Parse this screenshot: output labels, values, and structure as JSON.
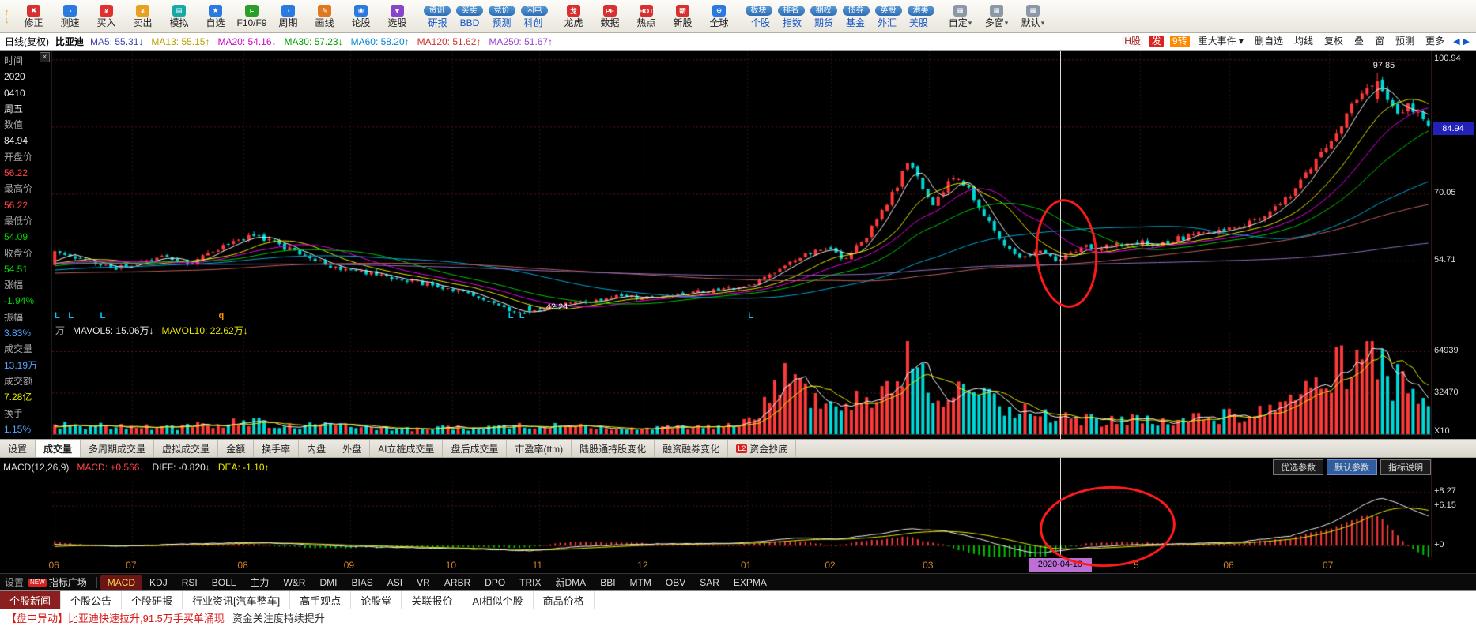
{
  "toolbar": {
    "nav_up": "↑",
    "nav_down": "↓",
    "items": [
      {
        "label": "修正",
        "glyph": "✖",
        "ic": "#d83030"
      },
      {
        "label": "测速",
        "glyph": "◔",
        "ic": "#2a7ae0"
      },
      {
        "label": "买入",
        "glyph": "¥",
        "ic": "#e03030"
      },
      {
        "label": "卖出",
        "glyph": "¥",
        "ic": "#e8a020"
      },
      {
        "label": "模拟",
        "glyph": "▤",
        "ic": "#18a8a8"
      },
      {
        "label": "自选",
        "glyph": "★",
        "ic": "#2a7ae0"
      },
      {
        "label": "F10/F9",
        "glyph": "F",
        "ic": "#28a028"
      },
      {
        "label": "周期",
        "glyph": "◔",
        "ic": "#2a7ae0"
      },
      {
        "label": "画线",
        "glyph": "✎",
        "ic": "#e07820"
      },
      {
        "label": "论股",
        "glyph": "◉",
        "ic": "#2a7ae0"
      },
      {
        "label": "选股",
        "glyph": "▼",
        "ic": "#8844cc"
      }
    ],
    "pills_a": [
      "资讯",
      "买卖",
      "竞价",
      "闪电"
    ],
    "links_a": [
      "研报",
      "BBD",
      "预测",
      "科创"
    ],
    "mid_items": [
      {
        "label": "龙虎",
        "glyph": "龙",
        "ic": "#d83030"
      },
      {
        "label": "数据",
        "glyph": "PE",
        "ic": "#d83030"
      },
      {
        "label": "热点",
        "glyph": "HOT",
        "ic": "#d83030"
      },
      {
        "label": "新股",
        "glyph": "新",
        "ic": "#d83030"
      },
      {
        "label": "全球",
        "glyph": "⊕",
        "ic": "#2a7ae0"
      }
    ],
    "pills_b": [
      "板块",
      "排名",
      "期权",
      "债券",
      "英股",
      "港美"
    ],
    "links_b": [
      "个股",
      "指数",
      "期货",
      "基金",
      "外汇",
      "美股"
    ],
    "end_items": [
      {
        "label": "自定",
        "glyph": "▦"
      },
      {
        "label": "多窗",
        "glyph": "▦"
      },
      {
        "label": "默认",
        "glyph": "▦"
      }
    ],
    "caret": "▾"
  },
  "chart_header": {
    "period": "日线(复权)",
    "stock": "比亚迪",
    "mas": [
      {
        "k": "MA5:",
        "v": "55.31",
        "d": "↓",
        "c": "#4444aa"
      },
      {
        "k": "MA13:",
        "v": "55.15",
        "d": "↑",
        "c": "#b8a000"
      },
      {
        "k": "MA20:",
        "v": "54.16",
        "d": "↓",
        "c": "#cc00cc"
      },
      {
        "k": "MA30:",
        "v": "57.23",
        "d": "↓",
        "c": "#00a000"
      },
      {
        "k": "MA60:",
        "v": "58.20",
        "d": "↑",
        "c": "#0088cc"
      },
      {
        "k": "MA120:",
        "v": "51.62",
        "d": "↑",
        "c": "#cc3333"
      },
      {
        "k": "MA250:",
        "v": "51.67",
        "d": "↑",
        "c": "#9944cc"
      }
    ],
    "right_items": [
      {
        "t": "H股",
        "bg": "#f7f7f7",
        "fg": "#aa2222"
      },
      {
        "t": "发",
        "bg": "#dd2222",
        "fg": "#ffffff"
      },
      {
        "t": "9转",
        "bg": "#ff8800",
        "fg": "#ffffff"
      },
      {
        "t": "重大事件 ▾",
        "bg": "",
        "fg": "#222222"
      },
      {
        "t": "删自选",
        "bg": "",
        "fg": "#222222"
      },
      {
        "t": "均线",
        "bg": "",
        "fg": "#222222"
      },
      {
        "t": "复权",
        "bg": "",
        "fg": "#222222"
      },
      {
        "t": "叠",
        "bg": "",
        "fg": "#222222"
      },
      {
        "t": "窗",
        "bg": "",
        "fg": "#222222"
      },
      {
        "t": "预测",
        "bg": "",
        "fg": "#222222"
      },
      {
        "t": "更多",
        "bg": "",
        "fg": "#222222"
      }
    ],
    "nav_left": "◀",
    "nav_right": "▶"
  },
  "info_panel": {
    "close_glyph": "×",
    "rows": [
      {
        "t": "时间",
        "c": "#a8a8a8"
      },
      {
        "t": "2020",
        "c": "#e8e8e8"
      },
      {
        "t": "0410",
        "c": "#e8e8e8"
      },
      {
        "t": "周五",
        "c": "#e8e8e8"
      },
      {
        "t": "数值",
        "c": "#a8a8a8"
      },
      {
        "t": "84.94",
        "c": "#e8e8e8"
      },
      {
        "t": "开盘价",
        "c": "#a8a8a8"
      },
      {
        "t": "56.22",
        "c": "#ff4545"
      },
      {
        "t": "最高价",
        "c": "#a8a8a8"
      },
      {
        "t": "56.22",
        "c": "#ff4545"
      },
      {
        "t": "最低价",
        "c": "#a8a8a8"
      },
      {
        "t": "54.09",
        "c": "#00d800"
      },
      {
        "t": "收盘价",
        "c": "#a8a8a8"
      },
      {
        "t": "54.51",
        "c": "#00d800"
      },
      {
        "t": "涨幅",
        "c": "#a8a8a8"
      },
      {
        "t": "-1.94%",
        "c": "#00d800"
      },
      {
        "t": "振幅",
        "c": "#a8a8a8"
      },
      {
        "t": "3.83%",
        "c": "#58a6ff"
      },
      {
        "t": "成交量",
        "c": "#a8a8a8"
      },
      {
        "t": "13.19万",
        "c": "#58a6ff"
      },
      {
        "t": "成交额",
        "c": "#a8a8a8"
      },
      {
        "t": "7.28亿",
        "c": "#e8e800"
      },
      {
        "t": "换手",
        "c": "#a8a8a8"
      },
      {
        "t": "1.15%",
        "c": "#58a6ff"
      }
    ]
  },
  "volume_header": {
    "unit": "万",
    "ma5_label": "MAVOL5:",
    "ma5_value": "15.06万",
    "ma5_dir": "↓",
    "ma10_label": "MAVOL10:",
    "ma10_value": "22.62万",
    "ma10_dir": "↓"
  },
  "func_tabs": {
    "items": [
      {
        "t": "设置"
      },
      {
        "t": "成交量",
        "active": true
      },
      {
        "t": "多周期成交量"
      },
      {
        "t": "虚拟成交量"
      },
      {
        "t": "金额"
      },
      {
        "t": "换手率"
      },
      {
        "t": "内盘"
      },
      {
        "t": "外盘"
      },
      {
        "t": "AI立桩成交量"
      },
      {
        "t": "盘后成交量"
      },
      {
        "t": "市盈率(ttm)"
      },
      {
        "t": "陆股通持股变化"
      },
      {
        "t": "融资融券变化"
      },
      {
        "t": "资金抄底",
        "badge": "L2"
      }
    ]
  },
  "macd_panel": {
    "title": "MACD(12,26,9)",
    "values": [
      {
        "k": "MACD:",
        "v": "+0.566",
        "d": "↓",
        "c": "#ff4545"
      },
      {
        "k": "DIFF:",
        "v": "-0.820",
        "d": "↓",
        "c": "#e8e8e8"
      },
      {
        "k": "DEA:",
        "v": "-1.10",
        "d": "↑",
        "c": "#e8e800"
      }
    ],
    "buttons": [
      {
        "t": "优选参数"
      },
      {
        "t": "默认参数",
        "active": true
      },
      {
        "t": "指标说明"
      }
    ]
  },
  "indicator_tabs": {
    "settings": "设置",
    "new_badge": "NEW",
    "plaza": "指标广场",
    "items": [
      {
        "t": "MACD",
        "active": true
      },
      {
        "t": "KDJ"
      },
      {
        "t": "RSI"
      },
      {
        "t": "BOLL"
      },
      {
        "t": "主力"
      },
      {
        "t": "W&R"
      },
      {
        "t": "DMI"
      },
      {
        "t": "BIAS"
      },
      {
        "t": "ASI"
      },
      {
        "t": "VR"
      },
      {
        "t": "ARBR"
      },
      {
        "t": "DPO"
      },
      {
        "t": "TRIX"
      },
      {
        "t": "新DMA"
      },
      {
        "t": "BBI"
      },
      {
        "t": "MTM"
      },
      {
        "t": "OBV"
      },
      {
        "t": "SAR"
      },
      {
        "t": "EXPMA"
      }
    ]
  },
  "news_tabs": {
    "items": [
      {
        "t": "个股新闻",
        "active": true
      },
      {
        "t": "个股公告"
      },
      {
        "t": "个股研报"
      },
      {
        "t": "行业资讯[汽车整车]"
      },
      {
        "t": "高手观点"
      },
      {
        "t": "论股堂"
      },
      {
        "t": "关联报价"
      },
      {
        "t": "AI相似个股"
      },
      {
        "t": "商品价格"
      }
    ]
  },
  "news_area": {
    "headline_red": "【盘中异动】比亚迪快速拉升,91.5万手买单涌现",
    "headline_black": "资金关注度持续提升"
  },
  "crosshair": {
    "date": "2020-04-10",
    "price": "84.94",
    "price_value": 84.94,
    "x_fraction": 0.731
  },
  "annotations": {
    "low_label": "←42.24",
    "low_f": 0.352,
    "low_price": 44.0,
    "high_label": "97.85",
    "high_f": 0.958,
    "high_price": 99.5,
    "markers": [
      {
        "t": "L",
        "f": 0.004,
        "c": "#00c8ff"
      },
      {
        "t": "L",
        "f": 0.014,
        "c": "#00c8ff"
      },
      {
        "t": "L",
        "f": 0.037,
        "c": "#00c8ff"
      },
      {
        "t": "q",
        "f": 0.123,
        "c": "#ff9000"
      },
      {
        "t": "L",
        "f": 0.333,
        "c": "#00c8ff"
      },
      {
        "t": "L",
        "f": 0.341,
        "c": "#00c8ff"
      },
      {
        "t": "L",
        "f": 0.507,
        "c": "#00c8ff"
      }
    ]
  },
  "chart_data": {
    "type": "candlestick",
    "symbol": "比亚迪",
    "period": "日线(复权)",
    "candle_count": 270,
    "price_range": [
      40.5,
      103
    ],
    "price_gridlines": [
      100.94,
      85.5,
      70.05,
      54.71
    ],
    "price_axis_labels": [
      {
        "v": 100.94,
        "t": "100.94"
      },
      {
        "v": 70.05,
        "t": "70.05"
      },
      {
        "v": 54.71,
        "t": "54.71"
      }
    ],
    "key_points": {
      "low": 42.24,
      "high": 97.85,
      "crosshair_price": 84.94,
      "crosshair_date": "2020-04-10"
    },
    "price_anchors": [
      [
        0,
        56.5
      ],
      [
        0.02,
        55
      ],
      [
        0.045,
        53
      ],
      [
        0.058,
        54
      ],
      [
        0.08,
        55.5
      ],
      [
        0.1,
        54
      ],
      [
        0.125,
        58.5
      ],
      [
        0.145,
        60.5
      ],
      [
        0.165,
        58
      ],
      [
        0.2,
        53.5
      ],
      [
        0.216,
        52.5
      ],
      [
        0.24,
        51
      ],
      [
        0.26,
        50
      ],
      [
        0.29,
        48
      ],
      [
        0.31,
        46
      ],
      [
        0.33,
        43.5
      ],
      [
        0.345,
        42.6
      ],
      [
        0.353,
        43.5
      ],
      [
        0.37,
        44.5
      ],
      [
        0.39,
        45.5
      ],
      [
        0.41,
        46.5
      ],
      [
        0.429,
        46
      ],
      [
        0.45,
        47
      ],
      [
        0.47,
        47.5
      ],
      [
        0.504,
        48.5
      ],
      [
        0.52,
        51
      ],
      [
        0.535,
        54
      ],
      [
        0.55,
        56.5
      ],
      [
        0.565,
        57.5
      ],
      [
        0.575,
        54.5
      ],
      [
        0.59,
        60
      ],
      [
        0.605,
        67
      ],
      [
        0.615,
        73
      ],
      [
        0.622,
        78.5
      ],
      [
        0.632,
        71
      ],
      [
        0.64,
        67
      ],
      [
        0.648,
        71.5
      ],
      [
        0.655,
        74.5
      ],
      [
        0.665,
        71
      ],
      [
        0.675,
        66
      ],
      [
        0.685,
        61
      ],
      [
        0.695,
        57.5
      ],
      [
        0.705,
        55
      ],
      [
        0.715,
        57
      ],
      [
        0.725,
        56
      ],
      [
        0.731,
        54.5
      ],
      [
        0.74,
        56.5
      ],
      [
        0.75,
        58
      ],
      [
        0.76,
        57.5
      ],
      [
        0.775,
        58.5
      ],
      [
        0.789,
        59
      ],
      [
        0.8,
        58
      ],
      [
        0.815,
        59.5
      ],
      [
        0.83,
        60.5
      ],
      [
        0.845,
        61.5
      ],
      [
        0.854,
        62
      ],
      [
        0.87,
        63.5
      ],
      [
        0.885,
        66
      ],
      [
        0.9,
        70
      ],
      [
        0.915,
        76
      ],
      [
        0.926,
        81
      ],
      [
        0.94,
        88
      ],
      [
        0.952,
        94
      ],
      [
        0.962,
        96.5
      ],
      [
        0.97,
        92
      ],
      [
        0.978,
        87.5
      ],
      [
        0.985,
        91
      ],
      [
        0.992,
        88.5
      ],
      [
        1,
        86
      ]
    ],
    "volume_max": 73000,
    "volume_gridlines": [
      64939,
      32470
    ],
    "volume_axis_labels": [
      {
        "v": 64939,
        "t": "64939"
      },
      {
        "v": 32470,
        "t": "32470"
      }
    ],
    "volume_unit_label": "X10",
    "volume_anchors": [
      [
        0,
        0.1
      ],
      [
        0.05,
        0.08
      ],
      [
        0.1,
        0.09
      ],
      [
        0.14,
        0.16
      ],
      [
        0.18,
        0.1
      ],
      [
        0.25,
        0.06
      ],
      [
        0.3,
        0.07
      ],
      [
        0.345,
        0.1
      ],
      [
        0.4,
        0.07
      ],
      [
        0.46,
        0.08
      ],
      [
        0.5,
        0.12
      ],
      [
        0.53,
        0.6
      ],
      [
        0.55,
        0.4
      ],
      [
        0.565,
        0.3
      ],
      [
        0.59,
        0.45
      ],
      [
        0.61,
        0.55
      ],
      [
        0.622,
        0.9
      ],
      [
        0.64,
        0.5
      ],
      [
        0.655,
        0.6
      ],
      [
        0.675,
        0.4
      ],
      [
        0.7,
        0.25
      ],
      [
        0.731,
        0.18
      ],
      [
        0.76,
        0.15
      ],
      [
        0.8,
        0.16
      ],
      [
        0.84,
        0.18
      ],
      [
        0.87,
        0.22
      ],
      [
        0.9,
        0.35
      ],
      [
        0.92,
        0.55
      ],
      [
        0.94,
        0.75
      ],
      [
        0.955,
        0.95
      ],
      [
        0.97,
        0.65
      ],
      [
        0.985,
        0.55
      ],
      [
        1,
        0.45
      ]
    ],
    "macd_range": [
      -1.8,
      10.6
    ],
    "macd_gridlines": [
      8.27,
      6.15,
      0
    ],
    "macd_axis_labels": [
      {
        "v": 8.27,
        "t": "+8.27"
      },
      {
        "v": 6.15,
        "t": "+6.15"
      },
      {
        "v": 0,
        "t": "+0"
      }
    ],
    "macd_anchors": [
      [
        0,
        0.2
      ],
      [
        0.05,
        -0.1
      ],
      [
        0.1,
        0.3
      ],
      [
        0.15,
        0.5
      ],
      [
        0.2,
        0
      ],
      [
        0.25,
        -0.3
      ],
      [
        0.3,
        -0.5
      ],
      [
        0.345,
        -0.8
      ],
      [
        0.38,
        -0.2
      ],
      [
        0.42,
        0.2
      ],
      [
        0.46,
        0.3
      ],
      [
        0.5,
        0.4
      ],
      [
        0.54,
        1.2
      ],
      [
        0.57,
        1
      ],
      [
        0.6,
        1.8
      ],
      [
        0.622,
        2.6
      ],
      [
        0.65,
        2.2
      ],
      [
        0.67,
        1.2
      ],
      [
        0.7,
        -0.6
      ],
      [
        0.715,
        -1.2
      ],
      [
        0.731,
        -0.82
      ],
      [
        0.75,
        -0.3
      ],
      [
        0.78,
        0.1
      ],
      [
        0.82,
        0.3
      ],
      [
        0.86,
        0.5
      ],
      [
        0.9,
        1.5
      ],
      [
        0.93,
        3.5
      ],
      [
        0.955,
        6.5
      ],
      [
        0.965,
        7.3
      ],
      [
        0.975,
        6.8
      ],
      [
        0.985,
        5.8
      ],
      [
        1,
        4.5
      ]
    ],
    "x_labels": [
      {
        "t": "06",
        "f": 0.002
      },
      {
        "t": "07",
        "f": 0.058
      },
      {
        "t": "08",
        "f": 0.139
      },
      {
        "t": "09",
        "f": 0.216
      },
      {
        "t": "10",
        "f": 0.29
      },
      {
        "t": "11",
        "f": 0.353
      },
      {
        "t": "12",
        "f": 0.429
      },
      {
        "t": "01",
        "f": 0.504
      },
      {
        "t": "02",
        "f": 0.565
      },
      {
        "t": "03",
        "f": 0.636
      },
      {
        "t": "5",
        "f": 0.789
      },
      {
        "t": "06",
        "f": 0.854
      },
      {
        "t": "07",
        "f": 0.926
      }
    ],
    "ma_lines": [
      {
        "period": 5,
        "color": "#f0f0f0"
      },
      {
        "period": 13,
        "color": "#e8e800"
      },
      {
        "period": 20,
        "color": "#e800e8"
      },
      {
        "period": 30,
        "color": "#00c800"
      },
      {
        "period": 60,
        "color": "#00a8d8"
      },
      {
        "period": 120,
        "color": "#c06060"
      },
      {
        "period": 250,
        "color": "#9070c0"
      }
    ],
    "colors": {
      "up": "#ff3a3a",
      "down": "#00d8d8",
      "grid": "#5a1a1a",
      "vgrid": "#2a1111",
      "macd_diff": "#f0f0f0",
      "macd_dea": "#e8e800",
      "volume_ma5": "#f0f0f0",
      "volume_ma10": "#e8e800"
    }
  }
}
